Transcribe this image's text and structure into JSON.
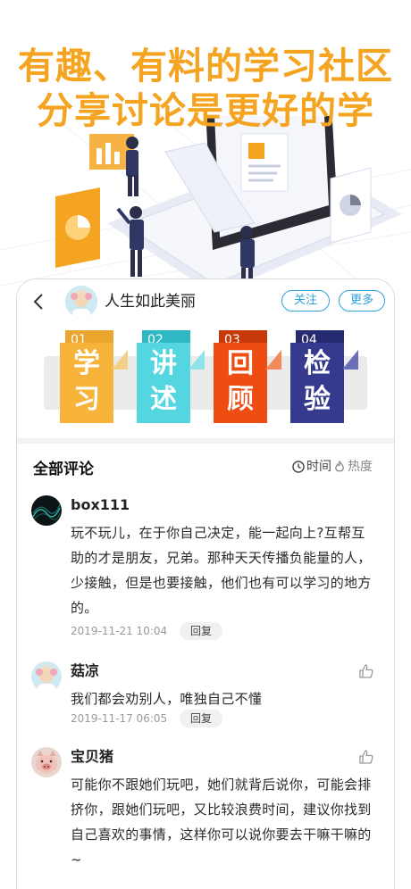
{
  "promo": {
    "headline_1": "有趣、有料的学习社区",
    "headline_2": "分享讨论是更好的学"
  },
  "header": {
    "back_icon": "chevron-left-icon",
    "username": "人生如此美丽",
    "follow_label": "关注",
    "more_label": "更多"
  },
  "cover": {
    "tiles": [
      {
        "num": "01",
        "char_1": "学",
        "char_2": "习",
        "color": "#f8b33a",
        "num_color": "#e9a52e"
      },
      {
        "num": "02",
        "char_1": "讲",
        "char_2": "述",
        "color": "#54d6e0",
        "num_color": "#2fb7c4"
      },
      {
        "num": "03",
        "char_1": "回",
        "char_2": "顾",
        "color": "#ee4d12",
        "num_color": "#c8390a"
      },
      {
        "num": "04",
        "char_1": "检",
        "char_2": "验",
        "color": "#363a8f",
        "num_color": "#262a6e"
      }
    ]
  },
  "comments_section": {
    "title": "全部评论",
    "sort_time": "时间",
    "sort_hot": "热度"
  },
  "comments": [
    {
      "name": "box111",
      "text": "玩不玩儿，在于你自己决定，能一起向上?互帮互助的才是朋友，兄弟。那种天天传播负能量的人，少接触，但是也要接触，他们也有可以学习的地方的。",
      "time": "2019-11-21 10:04",
      "reply": "回复"
    },
    {
      "name": "菇凉",
      "text": "我们都会劝别人，唯独自己不懂",
      "time": "2019-11-17 06:05",
      "reply": "回复"
    },
    {
      "name": "宝贝猪",
      "text": "可能你不跟她们玩吧，她们就背后说你，可能会排挤你，跟她们玩吧，又比较浪费时间，建议你找到自己喜欢的事情，这样你可以说你要去干嘛干嘛的~"
    }
  ]
}
